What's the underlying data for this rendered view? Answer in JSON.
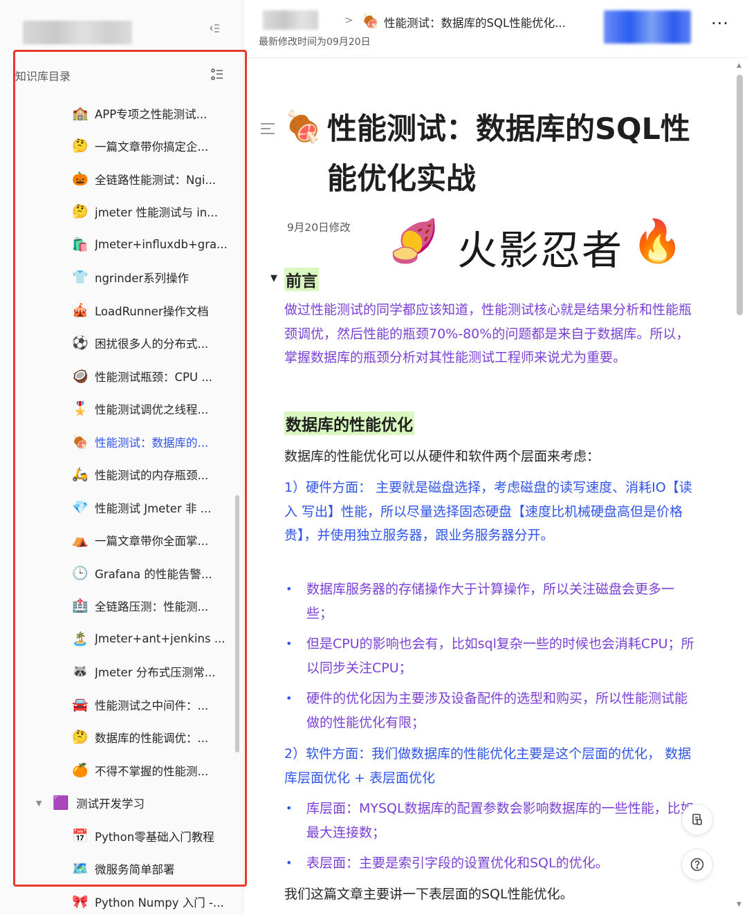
{
  "sidebar": {
    "section_title": "知识库目录",
    "items": [
      {
        "emoji": "🏫",
        "label": "APP专项之性能测试..."
      },
      {
        "emoji": "🤔",
        "label": "一篇文章带你搞定企..."
      },
      {
        "emoji": "🎃",
        "label": "全链路性能测试：Ngi..."
      },
      {
        "emoji": "🤔",
        "label": "jmeter 性能测试与 in..."
      },
      {
        "emoji": "🛍️",
        "label": "Jmeter+influxdb+gra..."
      },
      {
        "emoji": "👕",
        "label": "ngrinder系列操作"
      },
      {
        "emoji": "🎪",
        "label": "LoadRunner操作文档"
      },
      {
        "emoji": "⚽",
        "label": "困扰很多人的分布式..."
      },
      {
        "emoji": "🥥",
        "label": "性能测试瓶颈：CPU ..."
      },
      {
        "emoji": "🎖️",
        "label": "性能测试调优之线程..."
      },
      {
        "emoji": "🍖",
        "label": "性能测试：数据库的...",
        "active": true
      },
      {
        "emoji": "🛵",
        "label": "性能测试的内存瓶颈..."
      },
      {
        "emoji": "💎",
        "label": "性能测试 Jmeter 非 ..."
      },
      {
        "emoji": "⛺",
        "label": "一篇文章带你全面掌..."
      },
      {
        "emoji": "🕒",
        "label": "Grafana 的性能告警..."
      },
      {
        "emoji": "🏥",
        "label": "全链路压测：性能测..."
      },
      {
        "emoji": "🏝️",
        "label": "Jmeter+ant+jenkins ..."
      },
      {
        "emoji": "🦝",
        "label": "Jmeter 分布式压测常..."
      },
      {
        "emoji": "🚘",
        "label": "性能测试之中间件：..."
      },
      {
        "emoji": "🤔",
        "label": "数据库的性能调优：..."
      },
      {
        "emoji": "🍊",
        "label": "不得不掌握的性能测..."
      }
    ],
    "group": {
      "emoji": "🟪",
      "label": "测试开发学习"
    },
    "sub_items": [
      {
        "emoji": "📅",
        "label": "Python零基础入门教程"
      },
      {
        "emoji": "🗺️",
        "label": "微服务简单部署"
      },
      {
        "emoji": "🎀",
        "label": "Python Numpy 入门 -..."
      }
    ]
  },
  "header": {
    "separator": ">",
    "doc_icon": "🍖",
    "doc_title": "性能测试：数据库的SQL性能优化...",
    "modified": "最新修改时间为09月20日",
    "more": "···"
  },
  "content": {
    "title_icon": "🍖",
    "title": "性能测试：数据库的SQL性能优化实战",
    "modified_inline": "9月20日修改",
    "sticker": {
      "left": "🍠",
      "text": "火影忍者",
      "right": "🔥"
    },
    "preface_heading": "前言",
    "preface_text": "做过性能测试的同学都应该知道，性能测试核心就是结果分析和性能瓶颈调优，然后性能的瓶颈70%-80%的问题都是来自于数据库。所以，掌握数据库的瓶颈分析对其性能测试工程师来说尤为重要。",
    "db_heading": "数据库的性能优化",
    "db_intro": "数据库的性能优化可以从硬件和软件两个层面来考虑：",
    "hw_text": "1）硬件方面： 主要就是磁盘选择，考虑磁盘的读写速度、消耗IO【读入 写出】性能，所以尽量选择固态硬盘【速度比机械硬盘高但是价格贵】，并使用独立服务器，跟业务服务器分开。",
    "hw_bullets": [
      "数据库服务器的存储操作大于计算操作，所以关注磁盘会更多一些；",
      "但是CPU的影响也会有，比如sql复杂一些的时候也会消耗CPU；所以同步关注CPU；",
      "硬件的优化因为主要涉及设备配件的选型和购买，所以性能测试能做的性能优化有限；"
    ],
    "sw_text": "2）软件方面：我们做数据库的性能优化主要是这个层面的优化， 数据库层面优化 + 表层面优化",
    "sw_bullets": [
      "库层面：MYSQL数据库的配置参数会影响数据库的一些性能，比如最大连接数；",
      "表层面：主要是索引字段的设置优化和SQL的优化。"
    ],
    "closing": "我们这篇文章主要讲一下表层面的SQL性能优化。"
  },
  "colors": {
    "accent": "#2f54eb",
    "purple_text": "#7b3fd6",
    "heading_highlight": "#d9f7be",
    "annotation_frame": "#e8372f"
  }
}
